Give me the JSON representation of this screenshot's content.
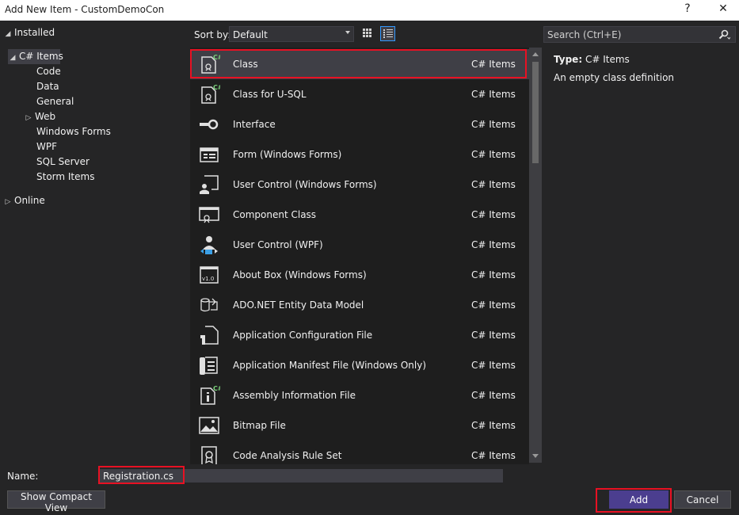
{
  "window": {
    "title": "Add New Item - CustomDemoCon",
    "help_label": "?",
    "close_label": "✕"
  },
  "tree": {
    "installed": "Installed",
    "csharp_items": "C# Items",
    "children": [
      "Code",
      "Data",
      "General",
      "Web",
      "Windows Forms",
      "WPF",
      "SQL Server",
      "Storm Items"
    ],
    "online": "Online"
  },
  "toolbar": {
    "sort_label": "Sort by:",
    "sort_value": "Default"
  },
  "search": {
    "placeholder": "Search (Ctrl+E)"
  },
  "items": [
    {
      "name": "Class",
      "category": "C# Items",
      "icon": "class-icon"
    },
    {
      "name": "Class for U-SQL",
      "category": "C# Items",
      "icon": "class-usql-icon"
    },
    {
      "name": "Interface",
      "category": "C# Items",
      "icon": "interface-icon"
    },
    {
      "name": "Form (Windows Forms)",
      "category": "C# Items",
      "icon": "form-icon"
    },
    {
      "name": "User Control (Windows Forms)",
      "category": "C# Items",
      "icon": "user-control-icon"
    },
    {
      "name": "Component Class",
      "category": "C# Items",
      "icon": "component-class-icon"
    },
    {
      "name": "User Control (WPF)",
      "category": "C# Items",
      "icon": "user-control-wpf-icon"
    },
    {
      "name": "About Box (Windows Forms)",
      "category": "C# Items",
      "icon": "about-box-icon"
    },
    {
      "name": "ADO.NET Entity Data Model",
      "category": "C# Items",
      "icon": "entity-data-model-icon"
    },
    {
      "name": "Application Configuration File",
      "category": "C# Items",
      "icon": "config-file-icon"
    },
    {
      "name": "Application Manifest File (Windows Only)",
      "category": "C# Items",
      "icon": "manifest-file-icon"
    },
    {
      "name": "Assembly Information File",
      "category": "C# Items",
      "icon": "assembly-info-icon"
    },
    {
      "name": "Bitmap File",
      "category": "C# Items",
      "icon": "bitmap-icon"
    },
    {
      "name": "Code Analysis Rule Set",
      "category": "C# Items",
      "icon": "rule-set-icon"
    }
  ],
  "details": {
    "type_label": "Type:",
    "type_value": "C# Items",
    "description": "An empty class definition"
  },
  "footer": {
    "name_label": "Name:",
    "name_value": "Registration.cs",
    "compact_view": "Show Compact View",
    "add": "Add",
    "cancel": "Cancel"
  },
  "colors": {
    "accent": "#4b3e8f",
    "highlight_outline": "#e81123",
    "background": "#252526",
    "list_background": "#1e1e1e",
    "selected_row": "#3f3f46",
    "csharp_badge": "#7cd37c"
  }
}
